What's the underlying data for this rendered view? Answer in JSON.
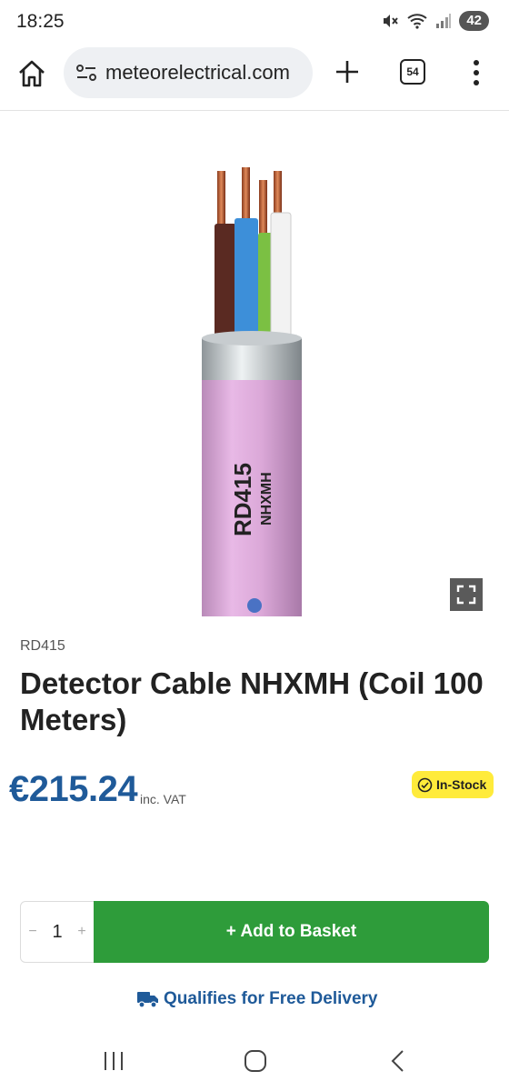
{
  "status": {
    "time": "18:25",
    "battery": "42"
  },
  "browser": {
    "url": "meteorelectrical.com",
    "tab_count": "54"
  },
  "product": {
    "cable_print_code": "RD415",
    "cable_print_type": "NHXMH",
    "sku": "RD415",
    "title": "Detector Cable NHXMH (Coil 100 Meters)",
    "price": "€215.24",
    "vat_note": "inc. VAT",
    "stock": "In-Stock"
  },
  "basket": {
    "qty_minus": "−",
    "qty": "1",
    "qty_plus": "+",
    "button_label": "+ Add to Basket"
  },
  "delivery_text": "Qualifies for Free Delivery",
  "colors": {
    "price": "#1f5a99",
    "basket": "#2e9c3a",
    "stock_badge": "#ffeb3b",
    "cable_sheath": "#d9a3d6"
  },
  "icons": [
    "mute-icon",
    "wifi-icon",
    "signal-icon",
    "home-icon",
    "site-info-icon",
    "plus-icon",
    "menu-icon",
    "expand-icon",
    "check-circle-icon",
    "truck-icon",
    "recents-icon",
    "nav-home-icon",
    "back-icon"
  ]
}
